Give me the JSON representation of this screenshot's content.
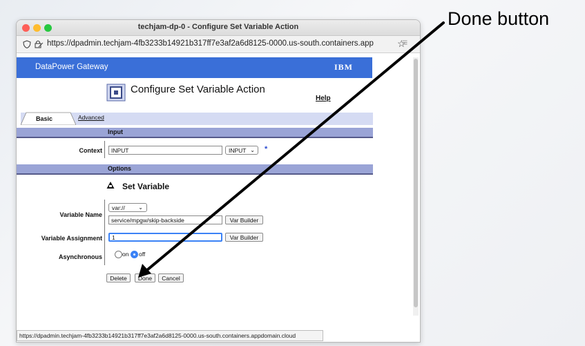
{
  "annotation": {
    "label": "Done button"
  },
  "window": {
    "title": "techjam-dp-0 - Configure Set Variable Action"
  },
  "browser": {
    "url": "https://dpadmin.techjam-4fb3233b14921b317ff7e3af2a6d8125-0000.us-south.containers.app",
    "status_url": "https://dpadmin.techjam-4fb3233b14921b317ff7e3af2a6d8125-0000.us-south.containers.appdomain.cloud"
  },
  "banner": {
    "title": "DataPower Gateway",
    "logo": "IBM"
  },
  "page": {
    "heading": "Configure Set Variable Action",
    "help": "Help"
  },
  "tabs": [
    {
      "label": "Basic",
      "active": true
    },
    {
      "label": "Advanced",
      "active": false
    }
  ],
  "sections": {
    "input": "Input",
    "options": "Options"
  },
  "context": {
    "label": "Context",
    "value": "INPUT",
    "select": "INPUT",
    "required_mark": "*"
  },
  "set_variable": {
    "title": "Set Variable"
  },
  "variable_name": {
    "label": "Variable Name",
    "scheme": "var://",
    "value": "service/mpgw/skip-backside",
    "builder": "Var Builder"
  },
  "variable_assignment": {
    "label": "Variable Assignment",
    "value": "1",
    "builder": "Var Builder"
  },
  "asynchronous": {
    "label": "Asynchronous",
    "on": "on",
    "off": "off",
    "selected": "off"
  },
  "actions": {
    "delete": "Delete",
    "done": "Done",
    "cancel": "Cancel"
  },
  "colors": {
    "banner": "#3a6fd8",
    "section": "#9aa4d6",
    "tabstrip": "#d5dbf3",
    "focus": "#3b82f6"
  }
}
